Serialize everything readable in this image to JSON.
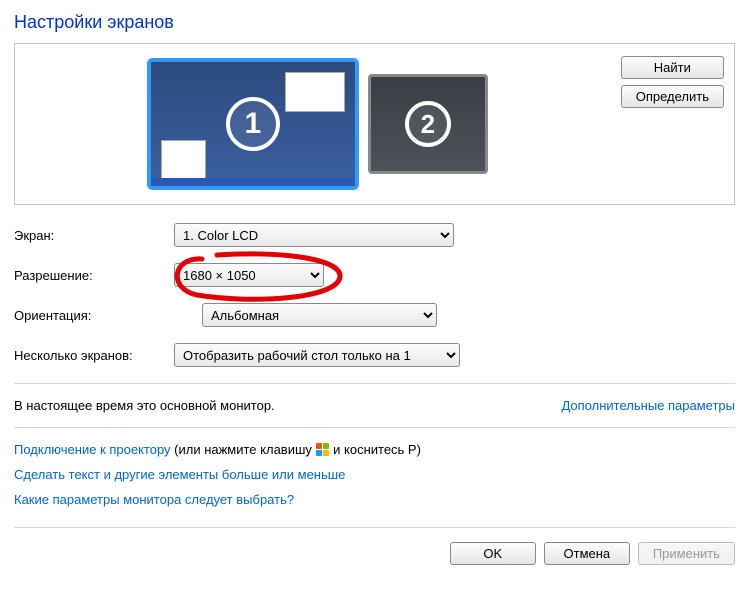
{
  "title": "Настройки экранов",
  "preview": {
    "monitors": [
      {
        "num": "1",
        "selected": true
      },
      {
        "num": "2",
        "selected": false
      }
    ],
    "buttons": {
      "find": "Найти",
      "identify": "Определить"
    }
  },
  "form": {
    "screen": {
      "label": "Экран:",
      "value": "1. Color LCD"
    },
    "resolution": {
      "label": "Разрешение:",
      "value": "1680 × 1050"
    },
    "orientation": {
      "label": "Ориентация:",
      "value": "Альбомная"
    },
    "multi": {
      "label": "Несколько экранов:",
      "value": "Отобразить рабочий стол только на 1"
    }
  },
  "status_text": "В настоящее время это основной монитор.",
  "adv_link": "Дополнительные параметры",
  "projector": {
    "link": "Подключение к проектору",
    "before": " (или нажмите клавишу ",
    "after": " и коснитесь P)"
  },
  "text_size_link": "Сделать текст и другие элементы больше или меньше",
  "which_params_link": "Какие параметры монитора следует выбрать?",
  "buttons": {
    "ok": "OK",
    "cancel": "Отмена",
    "apply": "Применить"
  }
}
